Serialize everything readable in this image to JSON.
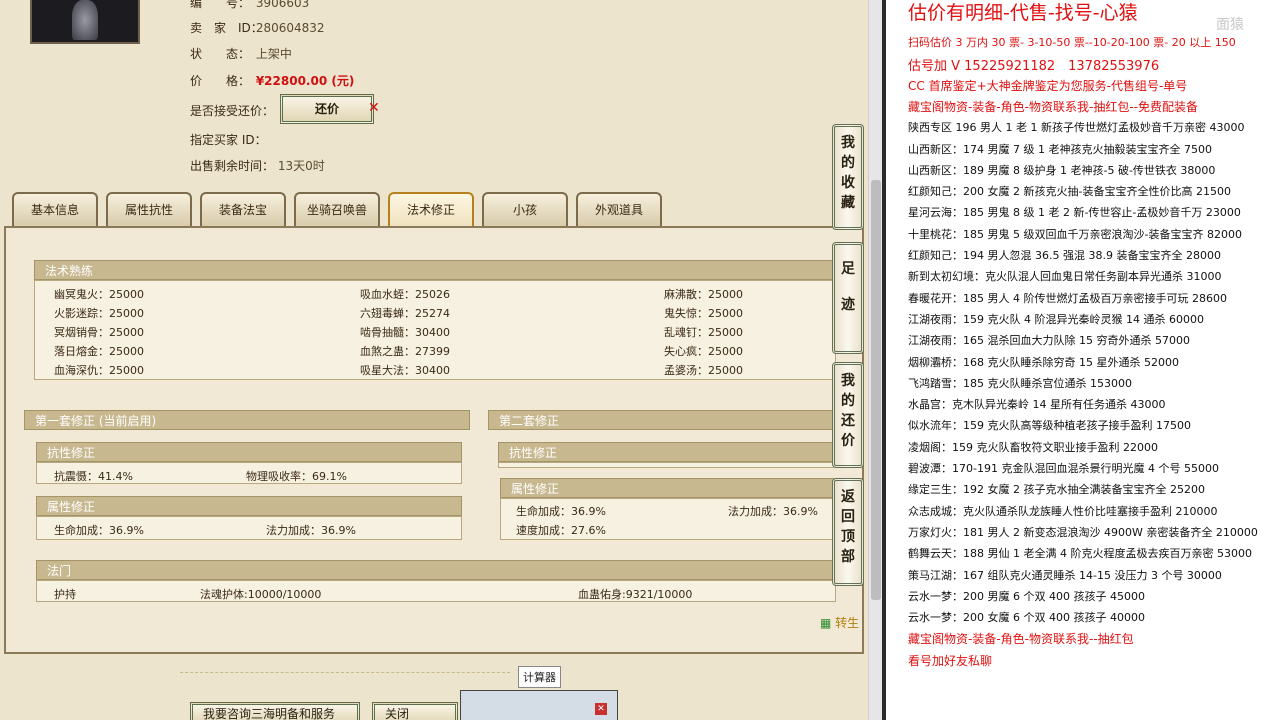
{
  "listing": {
    "number_label": "编　　号：",
    "number_value": "3906603",
    "seller_label": "卖　家　ID：",
    "seller_value": "280604832",
    "status_label": "状　　态：",
    "status_value": "上架中",
    "price_label": "价　　格：",
    "price_value": "¥22800.00 (元)",
    "accept_bargain_label": "是否接受还价：",
    "bargain_button": "还价",
    "buyer_label": "指定买家 ID：",
    "remaining_label": "出售剩余时间：",
    "remaining_value": "13天0时"
  },
  "tabs": [
    "基本信息",
    "属性抗性",
    "装备法宝",
    "坐骑召唤兽",
    "法术修正",
    "小孩",
    "外观道具"
  ],
  "active_tab": "法术修正",
  "spell_mastery": {
    "title": "法术熟练",
    "rows": [
      [
        "幽冥鬼火：25000",
        "吸血水蛭：25026",
        "麻沸散：25000"
      ],
      [
        "火影迷踪：25000",
        "六翅毒蝉：25274",
        "鬼失惊：25000"
      ],
      [
        "冥烟销骨：25000",
        "啮骨抽髓：30400",
        "乱魂钉：25000"
      ],
      [
        "落日熔金：25000",
        "血煞之蛊：27399",
        "失心疯：25000"
      ],
      [
        "血海深仇：25000",
        "吸星大法：30400",
        "孟婆汤：25000"
      ]
    ]
  },
  "set1": {
    "title": "第一套修正 (当前启用)",
    "resist_title": "抗性修正",
    "resist": [
      "抗震慑：41.4%",
      "物理吸收率：69.1%"
    ],
    "attr_title": "属性修正",
    "attr": [
      "生命加成：36.9%",
      "法力加成：36.9%"
    ]
  },
  "set2": {
    "title": "第二套修正",
    "resist_title": "抗性修正",
    "attr_title": "属性修正",
    "attr": [
      "生命加成：36.9%",
      "法力加成：36.9%",
      "速度加成：27.6%"
    ]
  },
  "fabao": {
    "title": "法门",
    "items": [
      "护持",
      "法魂护体:10000/10000",
      "血蛊佑身:9321/10000"
    ]
  },
  "side_buttons": [
    "我的收藏",
    "足迹",
    "我的还价",
    "返回顶部"
  ],
  "calc_link": "转生",
  "tooltip": "计算器",
  "bottom_buttons": [
    "我要咨询三海明备和服务",
    "关闭"
  ],
  "notes": {
    "title": "估价有明细-代售-找号-心猿",
    "watermark": "面猿",
    "lines": [
      {
        "text": "扫码估价 3 万内 30 票- 3-10-50 票--10-20-100 票- 20 以上 150",
        "red": true,
        "size": 11
      },
      {
        "text": "估号加 V 15225921182　13782553976",
        "red": true,
        "size": 13
      },
      {
        "text": "CC 首席鉴定+大神金牌鉴定为您服务-代售组号-单号",
        "red": true,
        "size": 12
      },
      {
        "text": "藏宝阁物资-装备-角色-物资联系我-抽红包--免费配装备",
        "red": true,
        "size": 12
      },
      {
        "text": "陕西专区 196 男人 1 老 1 新孩子传世燃灯孟极妙音千万亲密 43000",
        "red": false,
        "size": 11
      },
      {
        "text": "山西新区：174 男魔 7 级 1 老神孩克火抽毅装宝宝齐全 7500",
        "red": false,
        "size": 11
      },
      {
        "text": "山西新区：189 男魔 8 级护身 1 老神孩-5 破-传世铁衣 38000",
        "red": false,
        "size": 11
      },
      {
        "text": "红颜知己：200 女魔 2 新孩克火抽-装备宝宝齐全性价比高 21500",
        "red": false,
        "size": 11
      },
      {
        "text": "星河云海：185 男鬼 8 级 1 老 2 新-传世容止-孟极妙音千万 23000",
        "red": false,
        "size": 11
      },
      {
        "text": "十里桃花：185 男鬼 5 级双回血千万亲密浪淘沙-装备宝宝齐 82000",
        "red": false,
        "size": 11
      },
      {
        "text": "红颜知己：194 男人忽混 36.5 强混 38.9 装备宝宝齐全 28000",
        "red": false,
        "size": 11
      },
      {
        "text": "新到太初幻境：克火队混人回血鬼日常任务副本异光通杀 31000",
        "red": false,
        "size": 11
      },
      {
        "text": "春暖花开：185 男人 4 阶传世燃灯孟极百万亲密接手可玩 28600",
        "red": false,
        "size": 11
      },
      {
        "text": "江湖夜雨：159 克火队 4 阶混异光秦岭灵猴 14 通杀 60000",
        "red": false,
        "size": 11
      },
      {
        "text": "江湖夜雨：165 混杀回血大力队除 15 穷奇外通杀 57000",
        "red": false,
        "size": 11
      },
      {
        "text": "烟柳灞桥：168 克火队睡杀除穷奇 15 星外通杀 52000",
        "red": false,
        "size": 11
      },
      {
        "text": "飞鸿踏雪：185 克火队睡杀宫位通杀 153000",
        "red": false,
        "size": 11
      },
      {
        "text": "水晶宫：克木队异光秦岭 14 星所有任务通杀 43000",
        "red": false,
        "size": 11
      },
      {
        "text": "似水流年：159 克火队高等级种植老孩子接手盈利 17500",
        "red": false,
        "size": 11
      },
      {
        "text": "凌烟阁：159 克火队畜牧符文职业接手盈利 22000",
        "red": false,
        "size": 11
      },
      {
        "text": "碧波潭：170-191 克金队混回血混杀景行明光魔 4 个号 55000",
        "red": false,
        "size": 11
      },
      {
        "text": "缘定三生：192 女魔 2 孩子克水抽全满装备宝宝齐全 25200",
        "red": false,
        "size": 11
      },
      {
        "text": "众志成城：克火队通杀队龙族睡人性价比哇塞接手盈利 210000",
        "red": false,
        "size": 11
      },
      {
        "text": "万家灯火：181 男人 2 新变态混浪淘沙 4900W 亲密装备齐全 210000",
        "red": false,
        "size": 11
      },
      {
        "text": "鹤舞云天：188 男仙 1 老全满 4 阶克火程度孟极去疾百万亲密 53000",
        "red": false,
        "size": 11
      },
      {
        "text": "策马江湖：167 组队克火通灵睡杀 14-15 没压力 3 个号 30000",
        "red": false,
        "size": 11
      },
      {
        "text": "云水一梦：200 男魔 6 个双 400 孩孩子 45000",
        "red": false,
        "size": 11
      },
      {
        "text": "云水一梦：200 女魔 6 个双 400 孩孩子 40000",
        "red": false,
        "size": 11
      },
      {
        "text": "藏宝阁物资-装备-角色-物资联系我--抽红包",
        "red": true,
        "size": 12
      },
      {
        "text": "看号加好友私聊",
        "red": true,
        "size": 12
      }
    ]
  }
}
